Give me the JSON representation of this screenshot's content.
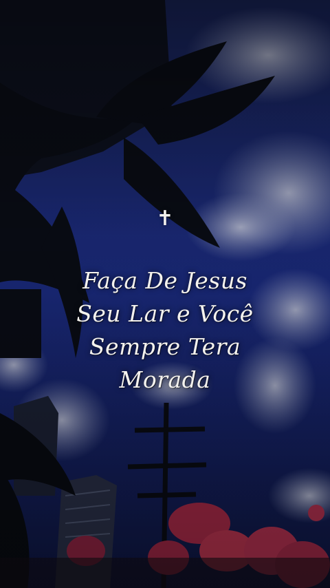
{
  "overlay": {
    "symbol": "✝",
    "quote_lines": [
      "Faça De Jesus",
      "Seu Lar e Você",
      "Sempre Tera",
      "Morada"
    ]
  },
  "colors": {
    "sky": "#1a2a7a",
    "sky_dark": "#0b1233",
    "cloud": "#c9cde0",
    "silhouette": "#0d1018",
    "flowers": "#c0304e",
    "text": "#f4f2ee"
  }
}
